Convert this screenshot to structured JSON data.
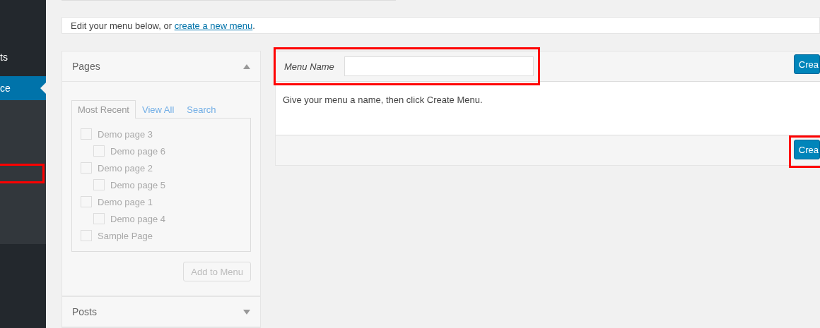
{
  "sidebar": {
    "items": [
      {
        "label": "ts",
        "selected": false
      },
      {
        "label": "ce",
        "selected": true
      }
    ],
    "submenu_marked": true
  },
  "notice": {
    "text": "Edit your menu below, or ",
    "link": "create a new menu",
    "after": "."
  },
  "pages_panel": {
    "title": "Pages",
    "expanded": true,
    "tabs": [
      {
        "label": "Most Recent",
        "selected": true
      },
      {
        "label": "View All",
        "selected": false
      },
      {
        "label": "Search",
        "selected": false
      }
    ],
    "items": [
      {
        "label": "Demo page 3",
        "checked": false,
        "children": [
          {
            "label": "Demo page 6",
            "checked": false
          }
        ]
      },
      {
        "label": "Demo page 2",
        "checked": false,
        "children": [
          {
            "label": "Demo page 5",
            "checked": false
          }
        ]
      },
      {
        "label": "Demo page 1",
        "checked": false,
        "children": [
          {
            "label": "Demo page 4",
            "checked": false
          }
        ]
      },
      {
        "label": "Sample Page",
        "checked": false
      }
    ],
    "button": {
      "label": "Add to Menu",
      "disabled": true
    }
  },
  "posts_panel": {
    "title": "Posts",
    "expanded": false
  },
  "menu_editor": {
    "name_label": "Menu Name",
    "name_marked": true,
    "top_button": {
      "label": "Crea",
      "marked": false
    },
    "instructions": "Give your menu a name, then click Create Menu.",
    "bottom_button": {
      "label": "Crea",
      "marked": true
    }
  }
}
